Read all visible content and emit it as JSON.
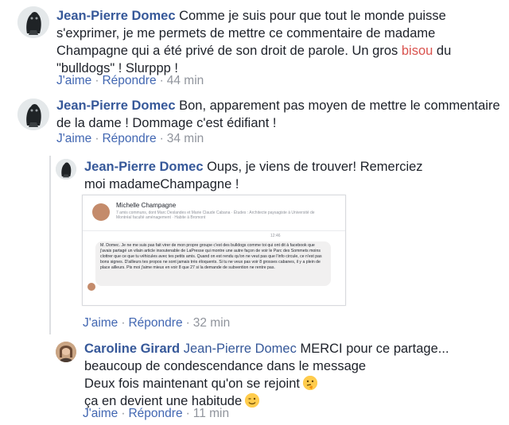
{
  "comments": [
    {
      "author": "Jean-Pierre Domec",
      "text_before": "Comme je suis pour que tout le monde puisse s'exprimer, je me permets de mettre ce commentaire de madame Champagne qui a été privé de son droit de parole. Un gros ",
      "highlight": "bisou",
      "text_after": " du \"bulldogs\" ! Slurppp !",
      "like": "J'aime",
      "reply": "Répondre",
      "time": "44 min"
    },
    {
      "author": "Jean-Pierre Domec",
      "text": "Bon, apparement pas moyen de mettre le commentaire de la dame ! Dommage c'est édifiant !",
      "like": "J'aime",
      "reply": "Répondre",
      "time": "34 min"
    },
    {
      "author": "Jean-Pierre Domec",
      "text": "Oups, je viens de trouver! Remerciez moi madameChampagne !",
      "like": "J'aime",
      "reply": "Répondre",
      "time": "32 min"
    },
    {
      "author": "Caroline Girard",
      "mention": "Jean-Pierre Domec",
      "line1": " MERCI pour ce partage...",
      "line2": "beaucoup de condescendance dans le message",
      "line3": "Deux fois maintenant qu'on se rejoint",
      "line4": "ça en devient une habitude",
      "emoji1": "thinking-face",
      "emoji2": "winking-face",
      "like": "J'aime",
      "reply": "Répondre",
      "time": "11 min"
    }
  ],
  "embedded_screenshot": {
    "name": "Michelle Champagne",
    "sub": "7 amis communs, dont Marc Deslandes et Marie Claude Cabana · Études : Architecte paysagiste à Université de Montréal faculté aménagement · Habite à Bromont",
    "time": "12:46",
    "message": "M. Domec. Je ne me suis pas fait virer de mon propre groupe c'est des bulldogs comme toi qui ont dit à facebook que j'avais partagé un vilain article insoutenable de LaPresse qui montre une autre façon de voir le Parc des Sommets moins clottrer que ce que tu véhicules avec tes petits amis. Quand on est rendu qu'on ne veut pas que l'info circule, ce n'est pas bons signes. D'ailleurs tes propos ne sont jamais très éloquents. Si tu ne veux pas voir 8 grosses cabanes, il y a plein de place ailleurs. Pis moi j'aime mieux en voir 8 que 27 si la demande de subvention ne rentre pas."
  }
}
